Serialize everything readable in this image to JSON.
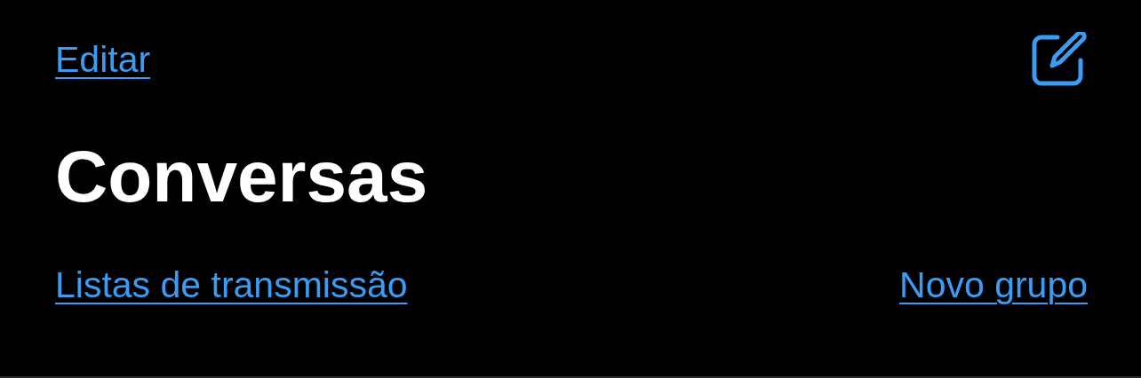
{
  "top_bar": {
    "edit_link": "Editar"
  },
  "title": "Conversas",
  "links": [
    {
      "label": "Listas de transmissão"
    },
    {
      "label": "Novo grupo"
    }
  ]
}
